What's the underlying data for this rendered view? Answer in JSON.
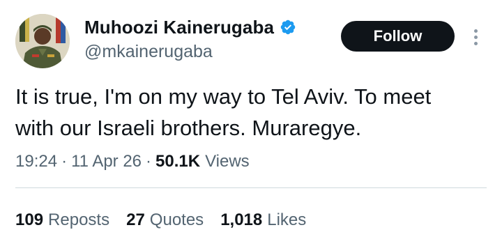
{
  "author": {
    "display_name": "Muhoozi Kainerugaba",
    "handle": "@mkainerugaba",
    "verified": true,
    "verified_badge_color": "#1d9bf0",
    "avatar_icon": "profile-photo-military-uniform"
  },
  "follow": {
    "label": "Follow"
  },
  "more_icon": "vertical-ellipsis-icon",
  "tweet": {
    "text": "It is true, I'm on my way to Tel Aviv. To meet\nwith our Israeli brothers. Muraregye."
  },
  "meta": {
    "time": "19:24",
    "date": "11 Apr 26",
    "separator": "·",
    "views_count": "50.1K",
    "views_label": "Views"
  },
  "stats": [
    {
      "count": "109",
      "label": "Reposts"
    },
    {
      "count": "27",
      "label": "Quotes"
    },
    {
      "count": "1,018",
      "label": "Likes"
    }
  ],
  "colors": {
    "text_primary": "#0f1419",
    "text_secondary": "#536471",
    "button_bg": "#0f1419",
    "divider": "#cfd9de"
  }
}
